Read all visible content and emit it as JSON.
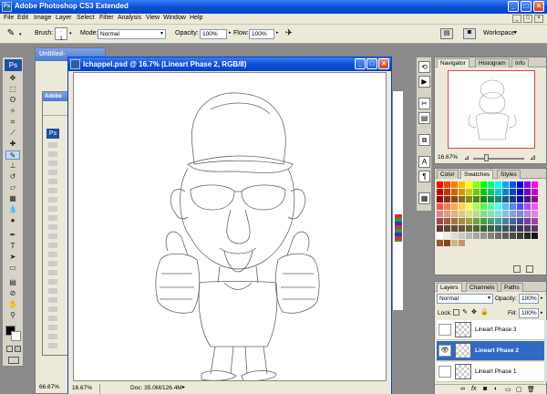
{
  "app": {
    "title": "Adobe Photoshop CS3 Extended"
  },
  "menu": [
    "File",
    "Edit",
    "Image",
    "Layer",
    "Select",
    "Filter",
    "Analysis",
    "View",
    "Window",
    "Help"
  ],
  "options": {
    "brush_label": "Brush:",
    "brush_size": "1",
    "mode_label": "Mode:",
    "mode_value": "Normal",
    "opacity_label": "Opacity:",
    "opacity_value": "100%",
    "flow_label": "Flow:",
    "flow_value": "100%",
    "workspace_label": "Workspace"
  },
  "toolbox": {
    "logo": "Ps"
  },
  "back_docs": {
    "doc1_title": "Untitled-",
    "doc2_title": "Adobe",
    "doc2_logo": "Ps",
    "doc1_zoom": "66.67%"
  },
  "document": {
    "title": "lchappel.psd @ 16.7% (Lineart Phase 2, RGB/8)",
    "zoom": "16.67%",
    "doc_size": "Doc: 35.0M/126.4M"
  },
  "navigator": {
    "tabs": [
      "Navigator",
      "Histogram",
      "Info"
    ],
    "zoom": "16.67%"
  },
  "swatches": {
    "tabs": [
      "Color",
      "Swatches",
      "Styles"
    ]
  },
  "layers": {
    "tabs": [
      "Layers",
      "Channels",
      "Paths"
    ],
    "blend_mode": "Normal",
    "opacity_label": "Opacity:",
    "opacity_value": "100%",
    "lock_label": "Lock:",
    "fill_label": "Fill:",
    "fill_value": "100%",
    "items": [
      {
        "name": "Lineart Phase 3",
        "visible": false,
        "active": false
      },
      {
        "name": "Lineart Phase 2",
        "visible": true,
        "active": true
      },
      {
        "name": "Lineart Phase 1",
        "visible": false,
        "active": false
      }
    ]
  },
  "colors": {
    "titlebar": "#0a4fd6",
    "selection": "#316ac5",
    "chrome": "#ece9d8"
  }
}
